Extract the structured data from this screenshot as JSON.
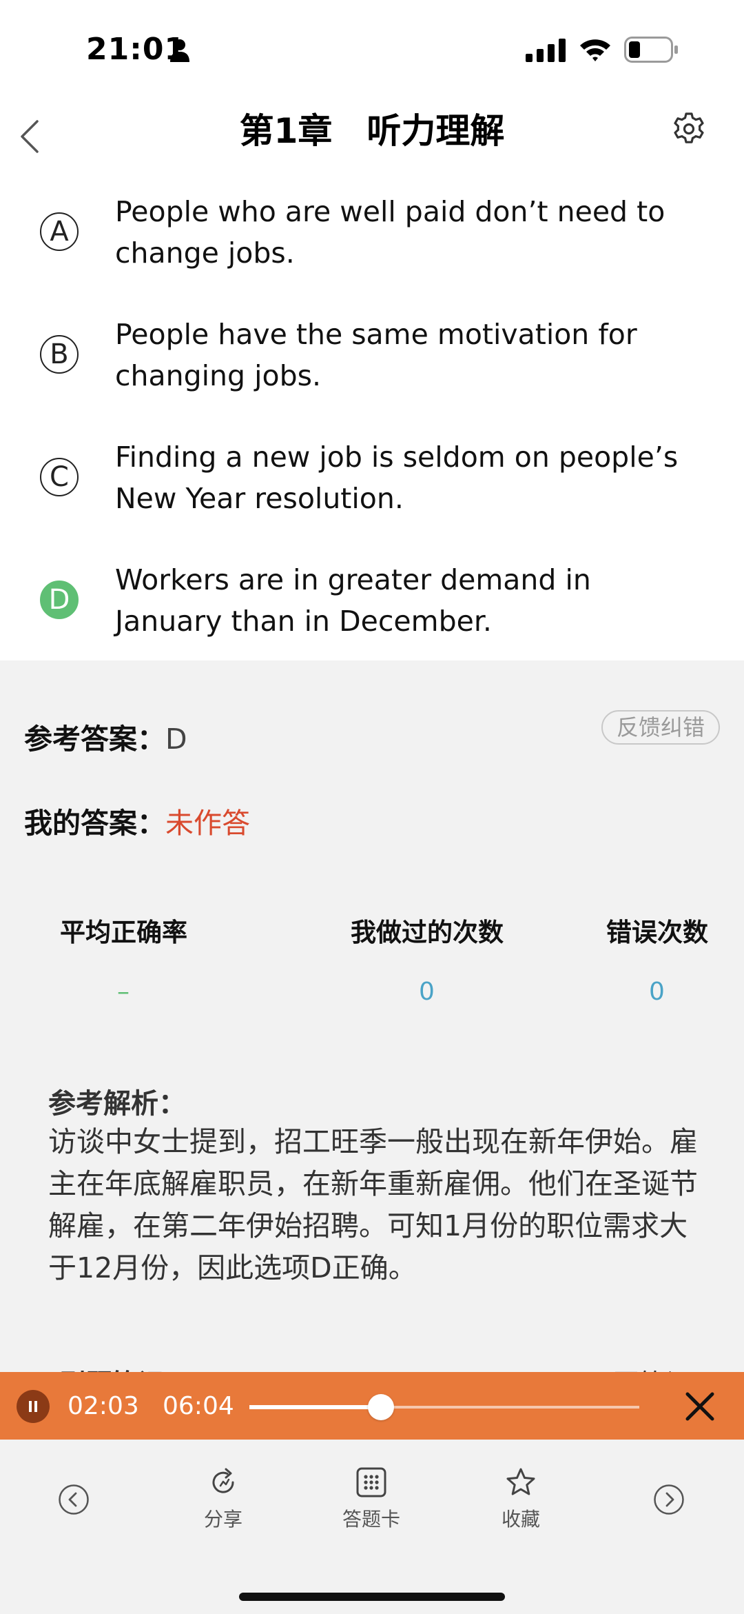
{
  "status_bar": {
    "time": "21:01"
  },
  "nav": {
    "title": "第1章　听力理解"
  },
  "options": [
    {
      "letter": "A",
      "text": "People who are well paid don’t need to change jobs.",
      "selected": false
    },
    {
      "letter": "B",
      "text": "People have the same motivation for changing jobs.",
      "selected": false
    },
    {
      "letter": "C",
      "text": "Finding a new job is seldom on people’s New Year resolution.",
      "selected": false
    },
    {
      "letter": "D",
      "text": "Workers are in greater demand in January than in December.",
      "selected": true
    }
  ],
  "answer": {
    "reference_label": "参考答案：",
    "reference_value": "D",
    "feedback_button": "反馈纠错",
    "mine_label": "我的答案：",
    "mine_value": "未作答"
  },
  "stats": [
    {
      "label": "平均正确率",
      "value": "–",
      "color": "#5fbf74"
    },
    {
      "label": "我做过的次数",
      "value": "0",
      "color": "#4aa3c7"
    },
    {
      "label": "错误次数",
      "value": "0",
      "color": "#4aa3c7"
    }
  ],
  "analysis": {
    "title": "参考解析：",
    "body": "访谈中女士提到，招工旺季一般出现在新年伊始。雇主在年底解雇职员，在新年重新雇佣。他们在圣诞节解雇，在第二年伊始招聘。可知1月份的职位需求大于12月份，因此选项D正确。"
  },
  "clipped_row": {
    "left": "刷题笔记",
    "right": "写笔记"
  },
  "player": {
    "current_time": "02:03",
    "total_time": "06:04",
    "progress": 0.338,
    "accent": "#e8793a"
  },
  "toolbar": {
    "prev_icon": "chevron-left-circle-icon",
    "share_label": "分享",
    "card_label": "答题卡",
    "favorite_label": "收藏",
    "next_icon": "chevron-right-circle-icon"
  }
}
